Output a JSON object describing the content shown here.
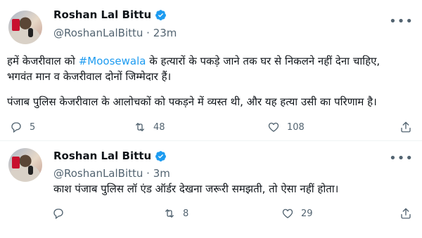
{
  "tweets": [
    {
      "author": "Roshan Lal Bittu",
      "handle": "@RoshanLalBittu",
      "time": "· 23m",
      "line1_before": "हमें केजरीवाल को ",
      "line1_hashtag": "#Moosewala",
      "line1_after": " के हत्यारों के पकड़े जाने तक घर से निकलने नहीं देना चाहिए,",
      "line2": "भगवंत मान व केजरीवाल दोनों जिम्मेदार हैं।",
      "line3": "पंजाब पुलिस केजरीवाल के आलोचकों को पकड़ने में व्यस्त थी, और यह हत्या उसी का परिणाम है।",
      "replies": "5",
      "retweets": "48",
      "likes": "108"
    },
    {
      "author": "Roshan Lal Bittu",
      "handle": "@RoshanLalBittu",
      "time": "· 3m",
      "line1": "काश पंजाब पुलिस लॉ एंड ऑर्डर देखना जरूरी समझती, तो ऐसा नहीं होता।",
      "replies": "",
      "retweets": "8",
      "likes": "29"
    }
  ],
  "icons": {
    "verified": "verified-badge-icon",
    "more": "more-options-icon",
    "reply": "reply-icon",
    "retweet": "retweet-icon",
    "like": "like-icon",
    "share": "share-icon"
  },
  "colors": {
    "accent": "#1d9bf0",
    "text": "#0f1419",
    "muted": "#536471"
  }
}
